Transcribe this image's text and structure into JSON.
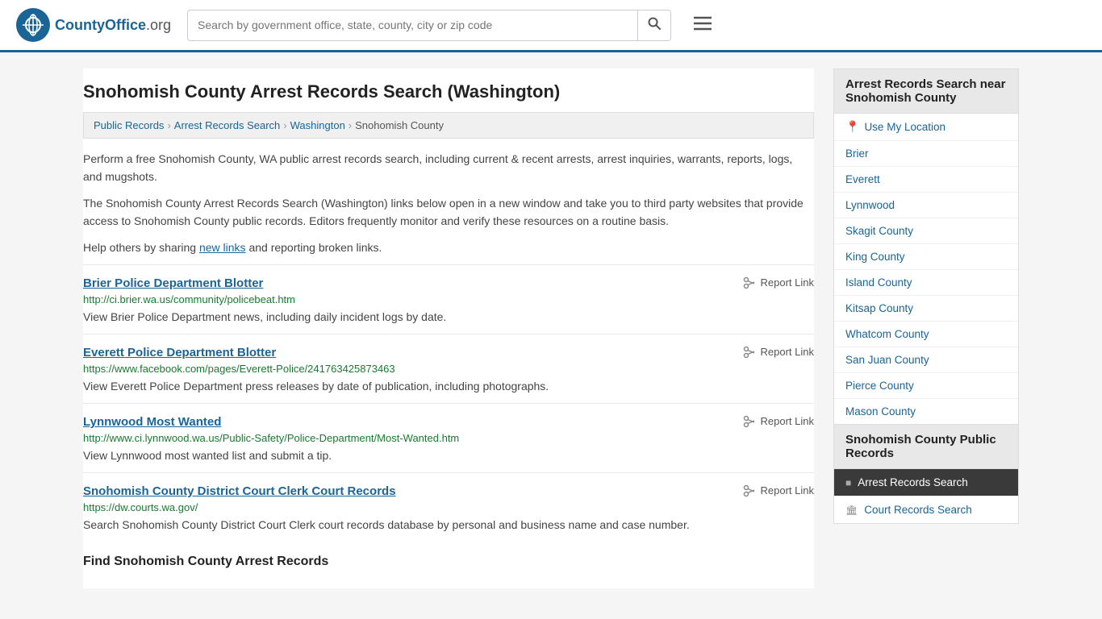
{
  "header": {
    "logo_text_main": "CountyOffice",
    "logo_text_ext": ".org",
    "search_placeholder": "Search by government office, state, county, city or zip code",
    "search_value": ""
  },
  "page": {
    "title": "Snohomish County Arrest Records Search (Washington)"
  },
  "breadcrumb": {
    "items": [
      {
        "label": "Public Records",
        "href": "#"
      },
      {
        "label": "Arrest Records Search",
        "href": "#"
      },
      {
        "label": "Washington",
        "href": "#"
      },
      {
        "label": "Snohomish County",
        "href": "#"
      }
    ]
  },
  "description": {
    "p1": "Perform a free Snohomish County, WA public arrest records search, including current & recent arrests, arrest inquiries, warrants, reports, logs, and mugshots.",
    "p2": "The Snohomish County Arrest Records Search (Washington) links below open in a new window and take you to third party websites that provide access to Snohomish County public records. Editors frequently monitor and verify these resources on a routine basis.",
    "p3_pre": "Help others by sharing ",
    "p3_link": "new links",
    "p3_post": " and reporting broken links."
  },
  "results": [
    {
      "title": "Brier Police Department Blotter",
      "url": "http://ci.brier.wa.us/community/policebeat.htm",
      "desc": "View Brier Police Department news, including daily incident logs by date.",
      "report_label": "Report Link"
    },
    {
      "title": "Everett Police Department Blotter",
      "url": "https://www.facebook.com/pages/Everett-Police/241763425873463",
      "desc": "View Everett Police Department press releases by date of publication, including photographs.",
      "report_label": "Report Link"
    },
    {
      "title": "Lynnwood Most Wanted",
      "url": "http://www.ci.lynnwood.wa.us/Public-Safety/Police-Department/Most-Wanted.htm",
      "desc": "View Lynnwood most wanted list and submit a tip.",
      "report_label": "Report Link"
    },
    {
      "title": "Snohomish County District Court Clerk Court Records",
      "url": "https://dw.courts.wa.gov/",
      "desc": "Search Snohomish County District Court Clerk court records database by personal and business name and case number.",
      "report_label": "Report Link"
    }
  ],
  "find_section_heading": "Find Snohomish County Arrest Records",
  "sidebar": {
    "nearby_title": "Arrest Records Search near Snohomish County",
    "use_location_label": "Use My Location",
    "nearby_links": [
      "Brier",
      "Everett",
      "Lynnwood",
      "Skagit County",
      "King County",
      "Island County",
      "Kitsap County",
      "Whatcom County",
      "San Juan County",
      "Pierce County",
      "Mason County"
    ],
    "public_records_title": "Snohomish County Public Records",
    "active_item": "Arrest Records Search",
    "inactive_item": "Court Records Search"
  }
}
